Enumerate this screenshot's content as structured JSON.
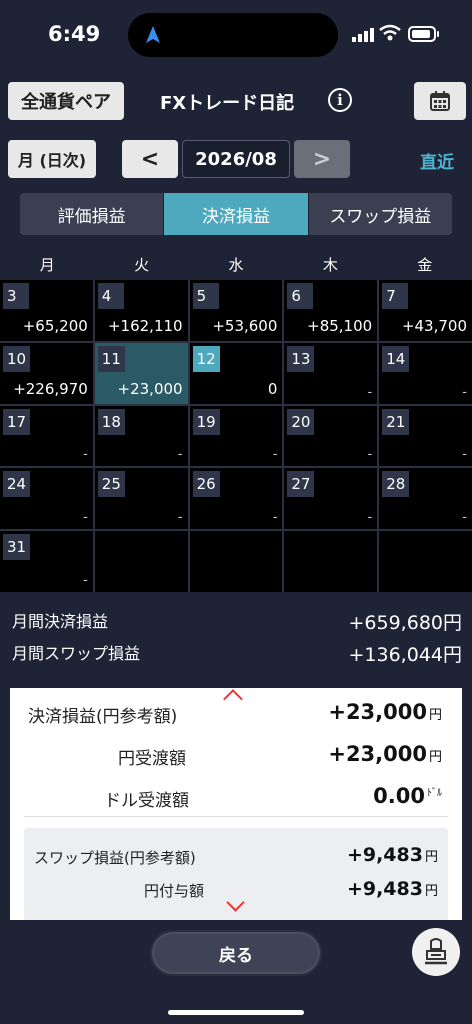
{
  "status_bar": {
    "time": "6:49"
  },
  "header": {
    "pair_button": "全通貨ペア",
    "title": "FXトレード日記",
    "info_icon": "i"
  },
  "period": {
    "mode_button": "月 (日次)",
    "prev": "<",
    "date": "2026/08",
    "next": ">",
    "latest": "直近"
  },
  "tabs": [
    {
      "label": "評価損益",
      "active": false
    },
    {
      "label": "決済損益",
      "active": true
    },
    {
      "label": "スワップ損益",
      "active": false
    }
  ],
  "calendar": {
    "weekdays": [
      "月",
      "火",
      "水",
      "木",
      "金"
    ],
    "cells": [
      {
        "day": "3",
        "value": "+65,200"
      },
      {
        "day": "4",
        "value": "+162,110"
      },
      {
        "day": "5",
        "value": "+53,600"
      },
      {
        "day": "6",
        "value": "+85,100"
      },
      {
        "day": "7",
        "value": "+43,700"
      },
      {
        "day": "10",
        "value": "+226,970"
      },
      {
        "day": "11",
        "value": "+23,000",
        "selected": true
      },
      {
        "day": "12",
        "value": "0",
        "today": true
      },
      {
        "day": "13",
        "value": "-"
      },
      {
        "day": "14",
        "value": "-"
      },
      {
        "day": "17",
        "value": "-"
      },
      {
        "day": "18",
        "value": "-"
      },
      {
        "day": "19",
        "value": "-"
      },
      {
        "day": "20",
        "value": "-"
      },
      {
        "day": "21",
        "value": "-"
      },
      {
        "day": "24",
        "value": "-"
      },
      {
        "day": "25",
        "value": "-"
      },
      {
        "day": "26",
        "value": "-"
      },
      {
        "day": "27",
        "value": "-"
      },
      {
        "day": "28",
        "value": "-"
      },
      {
        "day": "31",
        "value": "-"
      },
      {
        "day": "",
        "value": ""
      },
      {
        "day": "",
        "value": ""
      },
      {
        "day": "",
        "value": ""
      },
      {
        "day": "",
        "value": ""
      }
    ]
  },
  "summary": {
    "monthly_settle_label": "月間決済損益",
    "monthly_settle_value": "+659,680円",
    "monthly_swap_label": "月間スワップ損益",
    "monthly_swap_value": "+136,044円"
  },
  "detail": {
    "settle_label": "決済損益(円参考額)",
    "settle_value": "+23,000",
    "yen_transfer_label": "円受渡額",
    "yen_transfer_value": "+23,000",
    "dollar_transfer_label": "ドル受渡額",
    "dollar_transfer_value": "0.00",
    "yen_unit": "円",
    "dollar_unit": "ﾄﾞﾙ",
    "swap_label": "スワップ損益(円参考額)",
    "swap_value": "+9,483",
    "yen_grant_label": "円付与額",
    "yen_grant_value": "+9,483"
  },
  "bottom": {
    "back_button": "戻る"
  }
}
